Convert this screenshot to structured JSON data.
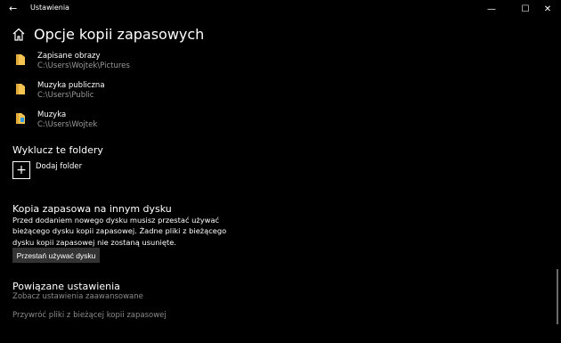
{
  "window": {
    "title": "Ustawienia",
    "back_glyph": "←",
    "minimize_glyph": "—",
    "maximize_glyph": "☐",
    "close_glyph": "✕"
  },
  "page": {
    "title": "Opcje kopii zapasowych"
  },
  "folders": [
    {
      "name": "Zapisane obrazy",
      "path": "C:\\Users\\Wojtek\\Pictures",
      "icon": "folder-icon"
    },
    {
      "name": "Muzyka publiczna",
      "path": "C:\\Users\\Public",
      "icon": "folder-icon"
    },
    {
      "name": "Muzyka",
      "path": "C:\\Users\\Wojtek",
      "icon": "music-folder-icon"
    }
  ],
  "exclude": {
    "heading": "Wyklucz te foldery",
    "add_label": "Dodaj folder",
    "plus_glyph": "+"
  },
  "other_drive": {
    "heading": "Kopia zapasowa na innym dysku",
    "description": "Przed dodaniem nowego dysku musisz przestać używać bieżącego dysku kopii zapasowej. Żadne pliki z bieżącego dysku kopii zapasowej nie zostaną usunięte.",
    "button_label": "Przestań używać dysku"
  },
  "related": {
    "heading": "Powiązane ustawienia",
    "links": [
      "Zobacz ustawienia zaawansowane",
      "Przywróć pliki z bieżącej kopii zapasowej"
    ]
  },
  "colors": {
    "background": "#000000",
    "folder_yellow": "#f5c451",
    "music_blue": "#2e9bdc",
    "button_bg": "#333333",
    "link_gray": "#8a8a8a"
  }
}
